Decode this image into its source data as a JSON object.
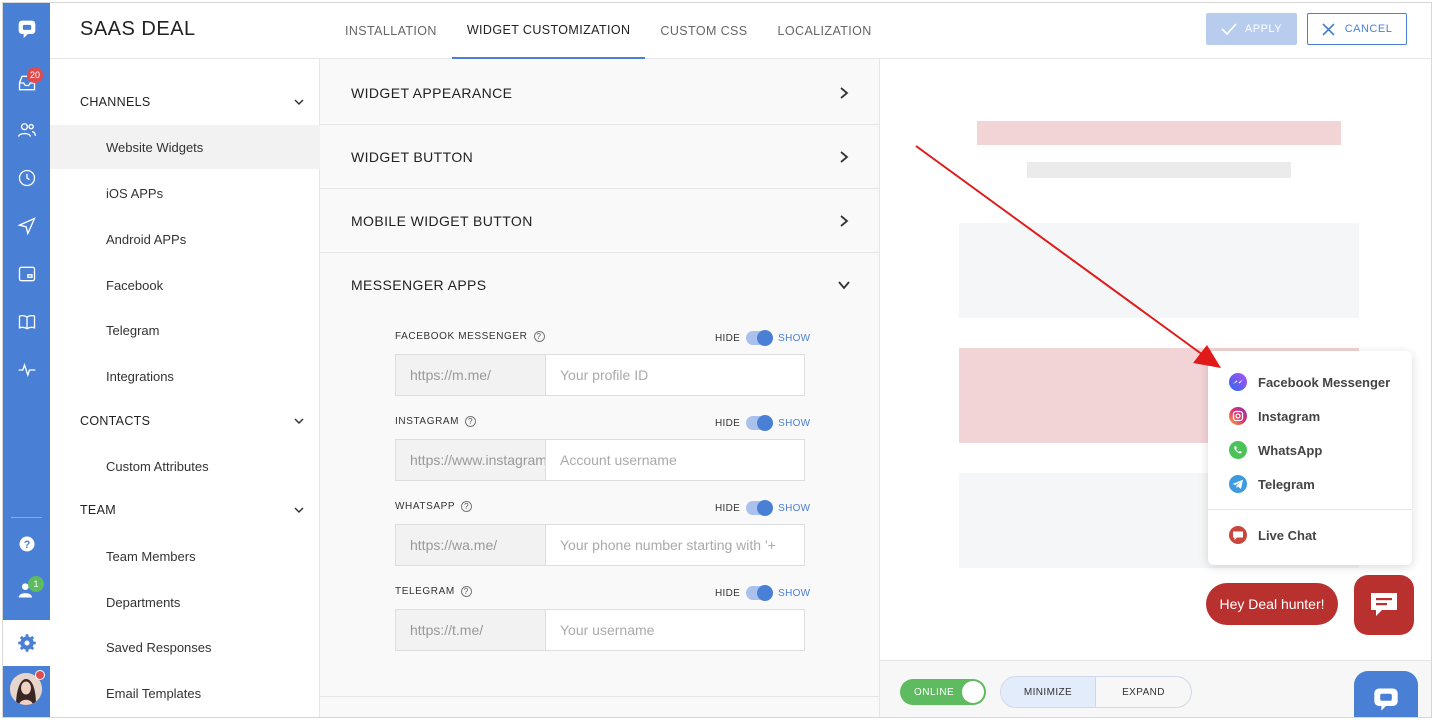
{
  "app": {
    "brand": "SAAS DEAL"
  },
  "rail": {
    "inbox_badge": "20",
    "visitors_badge": "1",
    "colors": {
      "rail": "#4a7fd6",
      "badge_red": "#e24b4b",
      "badge_green": "#5fbb5f"
    }
  },
  "tabs": [
    {
      "label": "INSTALLATION"
    },
    {
      "label": "WIDGET CUSTOMIZATION"
    },
    {
      "label": "CUSTOM CSS"
    },
    {
      "label": "LOCALIZATION"
    }
  ],
  "header": {
    "apply_label": "APPLY",
    "cancel_label": "CANCEL"
  },
  "sidebar": {
    "channels": {
      "title": "CHANNELS",
      "items": [
        "Website Widgets",
        "iOS APPs",
        "Android APPs",
        "Facebook",
        "Telegram",
        "Integrations"
      ]
    },
    "contacts": {
      "title": "CONTACTS",
      "items": [
        "Custom Attributes"
      ]
    },
    "team": {
      "title": "TEAM",
      "items": [
        "Team Members",
        "Departments",
        "Saved Responses",
        "Email Templates"
      ]
    }
  },
  "accordion": {
    "appearance": "WIDGET APPEARANCE",
    "button": "WIDGET BUTTON",
    "mobile_button": "MOBILE WIDGET BUTTON",
    "messenger_apps": "MESSENGER APPS"
  },
  "messenger_fields": [
    {
      "label": "FACEBOOK MESSENGER",
      "prefix": "https://m.me/",
      "placeholder": "Your profile ID",
      "hide": "HIDE",
      "show": "SHOW"
    },
    {
      "label": "INSTAGRAM",
      "prefix": "https://www.instagram.com/",
      "placeholder": "Account username",
      "hide": "HIDE",
      "show": "SHOW"
    },
    {
      "label": "WHATSAPP",
      "prefix": "https://wa.me/",
      "placeholder": "Your phone number starting with '+",
      "hide": "HIDE",
      "show": "SHOW"
    },
    {
      "label": "TELEGRAM",
      "prefix": "https://t.me/",
      "placeholder": "Your username",
      "hide": "HIDE",
      "show": "SHOW"
    }
  ],
  "preview": {
    "popup_items": [
      "Facebook Messenger",
      "Instagram",
      "WhatsApp",
      "Telegram"
    ],
    "live_chat": "Live Chat",
    "greeting": "Hey Deal hunter!",
    "online": "ONLINE",
    "minimize": "MINIMIZE",
    "expand": "EXPAND",
    "colors": {
      "chat_red": "#b8312f",
      "placeholder_pink": "#f2d4d6",
      "placeholder_grey": "#f5f6f7"
    }
  }
}
